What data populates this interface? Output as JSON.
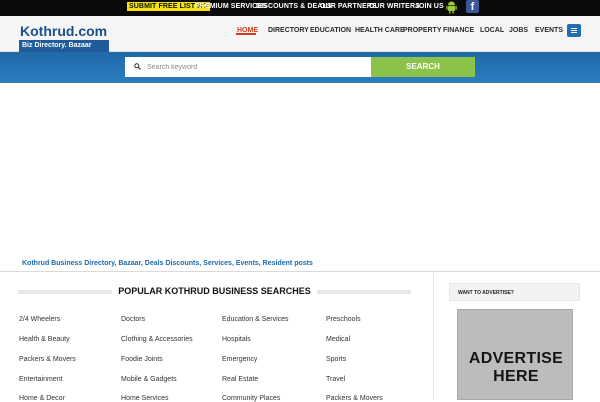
{
  "top_links": {
    "submit": "SUBMIT FREE LISTING",
    "premium": "PREMIUM SERVICES",
    "discounts": "DISCOUNTS & DEALS",
    "partners": "OUR PARTNERS",
    "writers": "OUR WRITERS",
    "join": "JOIN US",
    "facebook_glyph": "f"
  },
  "brand": {
    "name": "Kothrud.com",
    "sub": "Biz Directory. Bazaar"
  },
  "nav": {
    "home": "HOME",
    "directory": "DIRECTORY",
    "education": "EDUCATION",
    "health": "HEALTH CARE",
    "property": "PROPERTY",
    "finance": "FINANCE",
    "local": "LOCAL",
    "jobs": "JOBS",
    "events": "EVENTS"
  },
  "search": {
    "placeholder": "Search keyword",
    "button": "SEARCH"
  },
  "tagline": "Kothrud Business Directory, Bazaar, Deals Discounts, Services, Events, Resident posts",
  "popular": {
    "title": "POPULAR KOTHRUD BUSINESS SEARCHES",
    "columns": [
      [
        "2/4 Wheelers",
        "Health & Beauty",
        "Packers & Movers",
        "Entertainment",
        "Home & Decor"
      ],
      [
        "Doctors",
        "Clothing & Accessories",
        "Foodie Joints",
        "Mobile & Gadgets",
        "Home Services"
      ],
      [
        "Education & Services",
        "Hospitals",
        "Emergency",
        "Real Estate",
        "Community Places"
      ],
      [
        "Preschools",
        "Medical",
        "Sports",
        "Travel",
        "Packers & Movers"
      ]
    ]
  },
  "sidebar": {
    "heading": "WANT TO ADVERTISE?",
    "ad_line1": "ADVERTISE",
    "ad_line2": "HERE"
  },
  "colors": {
    "brand_blue": "#1f5c99",
    "search_green": "#8bc34a",
    "active_nav": "#d23b1c",
    "highlight_yellow": "#f4e20c"
  }
}
